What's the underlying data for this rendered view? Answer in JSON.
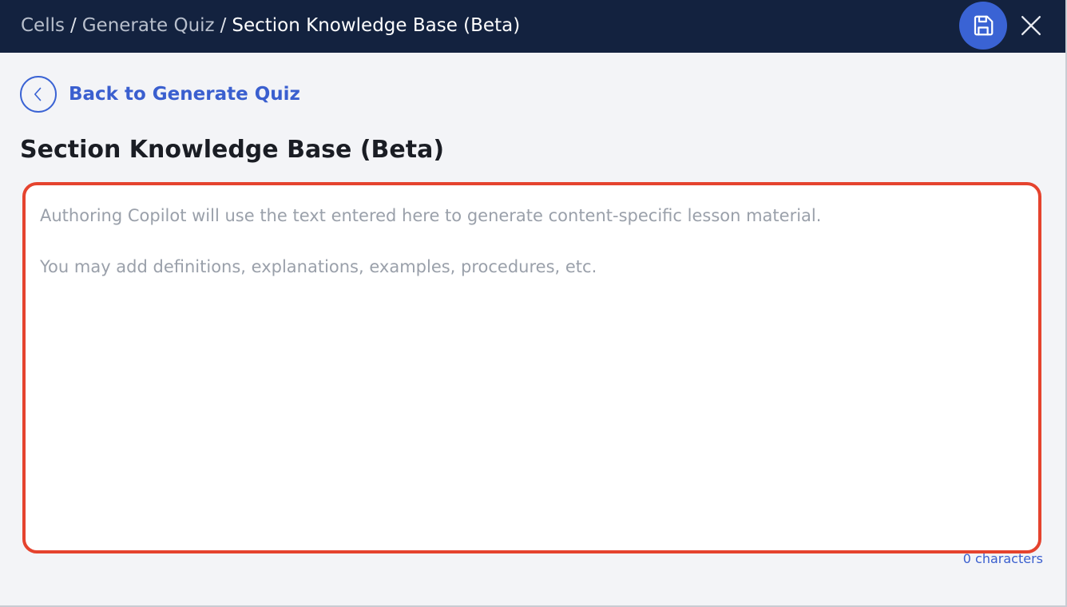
{
  "breadcrumb": {
    "items": [
      "Cells",
      "Generate Quiz"
    ],
    "separator": "/",
    "current": "Section Knowledge Base (Beta)"
  },
  "toolbar": {
    "save_icon": "save-icon",
    "close_icon": "close-icon"
  },
  "back_link": {
    "label": "Back to Generate Quiz",
    "icon": "chevron-left-icon"
  },
  "page_title": "Section Knowledge Base (Beta)",
  "knowledge_base": {
    "value": "",
    "placeholder": "Authoring Copilot will use the text entered here to generate content-specific lesson material.\n\nYou may add definitions, explanations, examples, procedures, etc.",
    "char_count": "0 characters"
  },
  "colors": {
    "topbar": "#13223f",
    "accent": "#3a63d4",
    "focus_border": "#e5432e",
    "background": "#f3f4f7"
  }
}
